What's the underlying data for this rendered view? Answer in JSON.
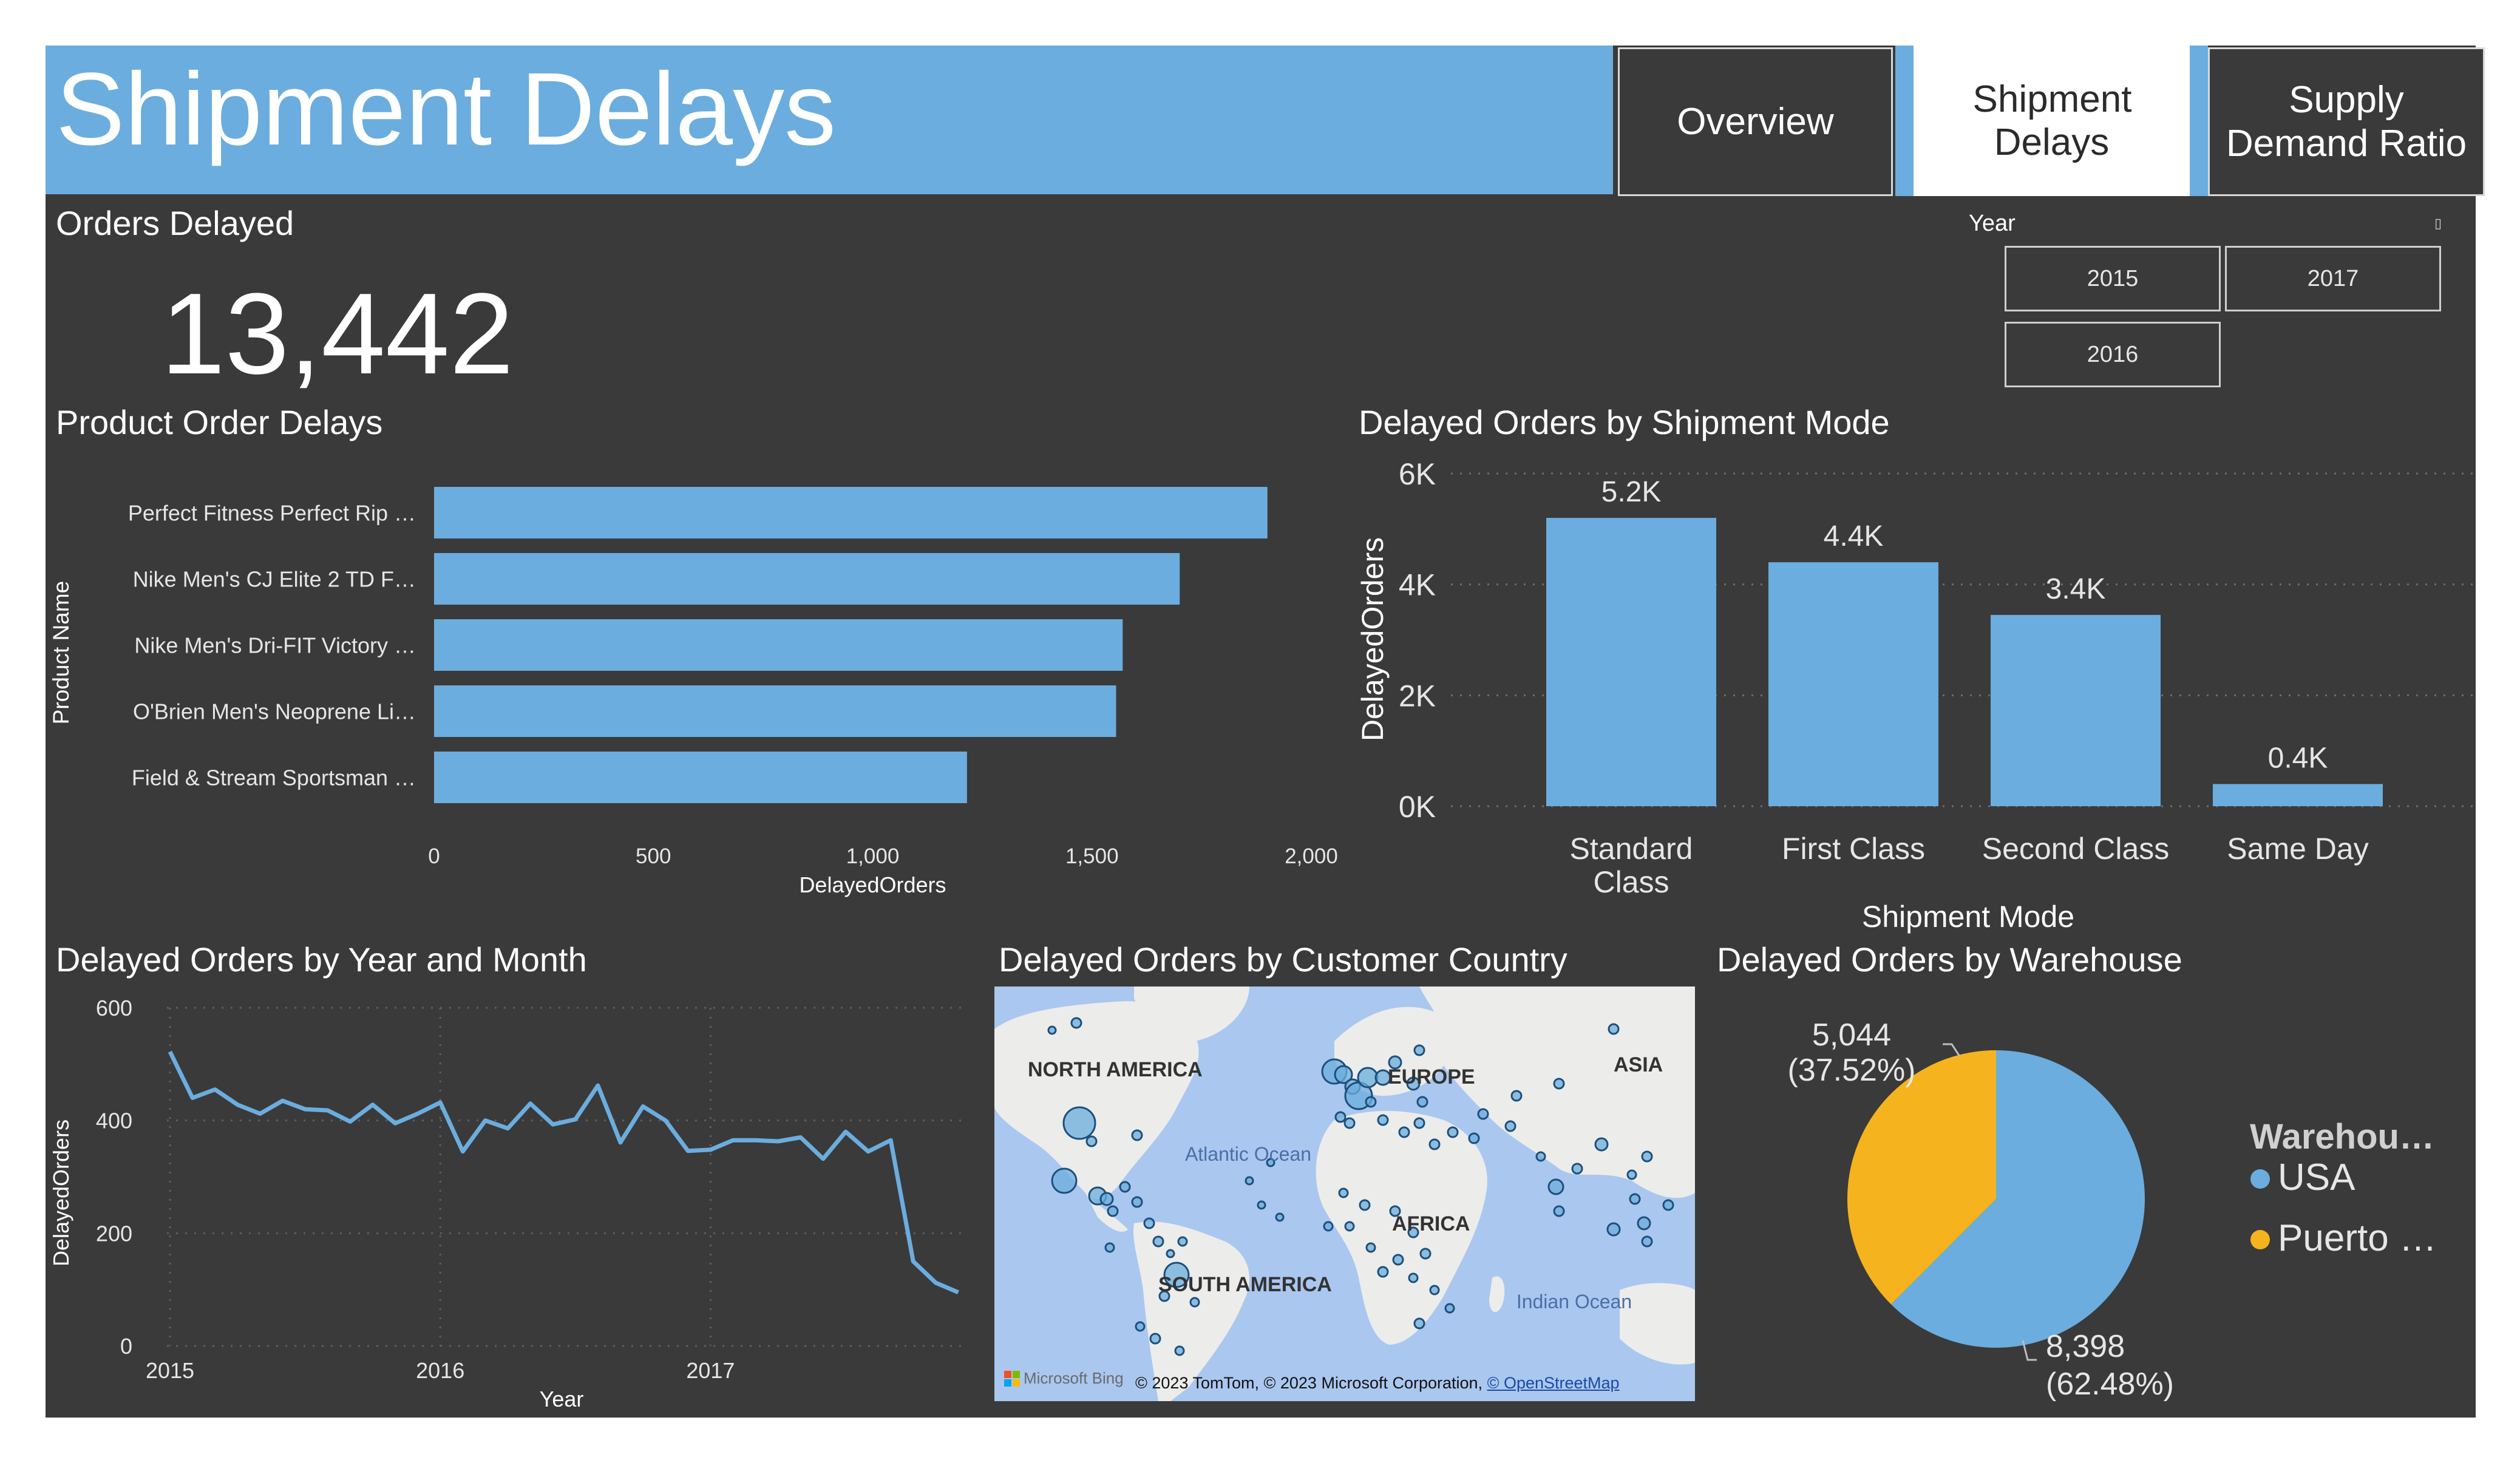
{
  "header": {
    "title": "Shipment Delays",
    "nav": [
      {
        "label": "Overview",
        "active": false
      },
      {
        "label": "Shipment Delays",
        "active": true
      },
      {
        "label": "Supply Demand Ratio",
        "active": false
      }
    ]
  },
  "kpi": {
    "label": "Orders Delayed",
    "value": "13,442"
  },
  "slicer": {
    "label": "Year",
    "options": [
      "2015",
      "2017",
      "2016"
    ],
    "clear_icon": "eraser-icon"
  },
  "colors": {
    "primary": "#6badde",
    "secondary": "#f5b31d",
    "background": "#3a3a3a"
  },
  "chart_data": [
    {
      "id": "product_delays",
      "type": "bar",
      "orientation": "horizontal",
      "title": "Product Order Delays",
      "xlabel": "DelayedOrders",
      "ylabel": "Product Name",
      "categories": [
        "Perfect Fitness Perfect Rip …",
        "Nike Men's CJ Elite 2 TD F…",
        "Nike Men's Dri-FIT Victory …",
        "O'Brien Men's Neoprene Li…",
        "Field & Stream Sportsman …"
      ],
      "values": [
        1900,
        1700,
        1570,
        1555,
        1215
      ],
      "xlim": [
        0,
        2000
      ],
      "xticks": [
        "0",
        "500",
        "1,000",
        "1,500",
        "2,000"
      ],
      "grid": false
    },
    {
      "id": "shipment_mode",
      "type": "bar",
      "title": "Delayed Orders by Shipment Mode",
      "xlabel": "Shipment Mode",
      "ylabel": "DelayedOrders",
      "categories": [
        "Standard Class",
        "First Class",
        "Second Class",
        "Same Day"
      ],
      "values": [
        5200,
        4400,
        3450,
        400
      ],
      "data_labels": [
        "5.2K",
        "4.4K",
        "3.4K",
        "0.4K"
      ],
      "ylim": [
        0,
        6000
      ],
      "yticks": [
        "0K",
        "2K",
        "4K",
        "6K"
      ],
      "grid": true
    },
    {
      "id": "year_month",
      "type": "line",
      "title": "Delayed Orders by Year and Month",
      "xlabel": "Year",
      "ylabel": "DelayedOrders",
      "ylim": [
        0,
        600
      ],
      "yticks": [
        "0",
        "200",
        "400",
        "600"
      ],
      "xticks": [
        "2015",
        "2016",
        "2017"
      ],
      "x": [
        "2015-01",
        "2015-02",
        "2015-03",
        "2015-04",
        "2015-05",
        "2015-06",
        "2015-07",
        "2015-08",
        "2015-09",
        "2015-10",
        "2015-11",
        "2015-12",
        "2016-01",
        "2016-02",
        "2016-03",
        "2016-04",
        "2016-05",
        "2016-06",
        "2016-07",
        "2016-08",
        "2016-09",
        "2016-10",
        "2016-11",
        "2016-12",
        "2017-01",
        "2017-02",
        "2017-03",
        "2017-04",
        "2017-05",
        "2017-06",
        "2017-07",
        "2017-08",
        "2017-09",
        "2017-10",
        "2017-11",
        "2017-12",
        "2018-01"
      ],
      "values": [
        522,
        440,
        455,
        428,
        412,
        435,
        420,
        418,
        398,
        428,
        395,
        412,
        432,
        345,
        400,
        386,
        430,
        393,
        402,
        462,
        361,
        425,
        400,
        346,
        348,
        365,
        365,
        363,
        370,
        332,
        380,
        345,
        365,
        150,
        112,
        95
      ],
      "grid": true
    },
    {
      "id": "warehouse",
      "type": "pie",
      "title": "Delayed Orders by Warehouse",
      "legend_title": "Warehou…",
      "legend_position": "right",
      "slices": [
        {
          "name": "USA",
          "value": 8398,
          "label": "8,398",
          "pct_label": "(62.48%)",
          "color": "#6badde"
        },
        {
          "name": "Puerto …",
          "value": 5044,
          "label": "5,044",
          "pct_label": "(37.52%)",
          "color": "#f5b31d"
        }
      ]
    }
  ],
  "map": {
    "title": "Delayed Orders by Customer Country",
    "labels": [
      "NORTH AMERICA",
      "EUROPE",
      "ASIA",
      "AFRICA",
      "SOUTH AMERICA"
    ],
    "ocean_labels": [
      "Atlantic Ocean",
      "Indian Ocean"
    ],
    "attribution": "© 2023 TomTom, © 2023 Microsoft Corporation, ",
    "attribution_link": "© OpenStreetMap",
    "logo": "Microsoft Bing"
  }
}
